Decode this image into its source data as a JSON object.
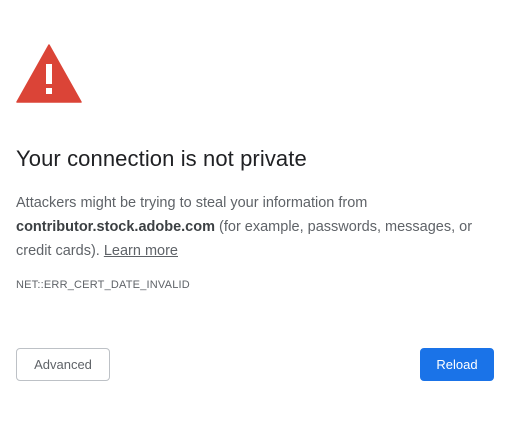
{
  "page": {
    "heading": "Your connection is not private",
    "explanation_before": "Attackers might be trying to steal your information from ",
    "host": "contributor.stock.adobe.com",
    "explanation_after": " (for example, passwords, messages, or credit cards). ",
    "learn_more": "Learn more",
    "error_code": "NET::ERR_CERT_DATE_INVALID"
  },
  "buttons": {
    "advanced_label": "Advanced",
    "reload_label": "Reload"
  },
  "colors": {
    "warning_red": "#db4437",
    "reload_blue": "#1a73e8",
    "heading_text": "#202124",
    "body_text": "#5f6368"
  },
  "icons": {
    "warning": "warning-triangle-icon"
  }
}
